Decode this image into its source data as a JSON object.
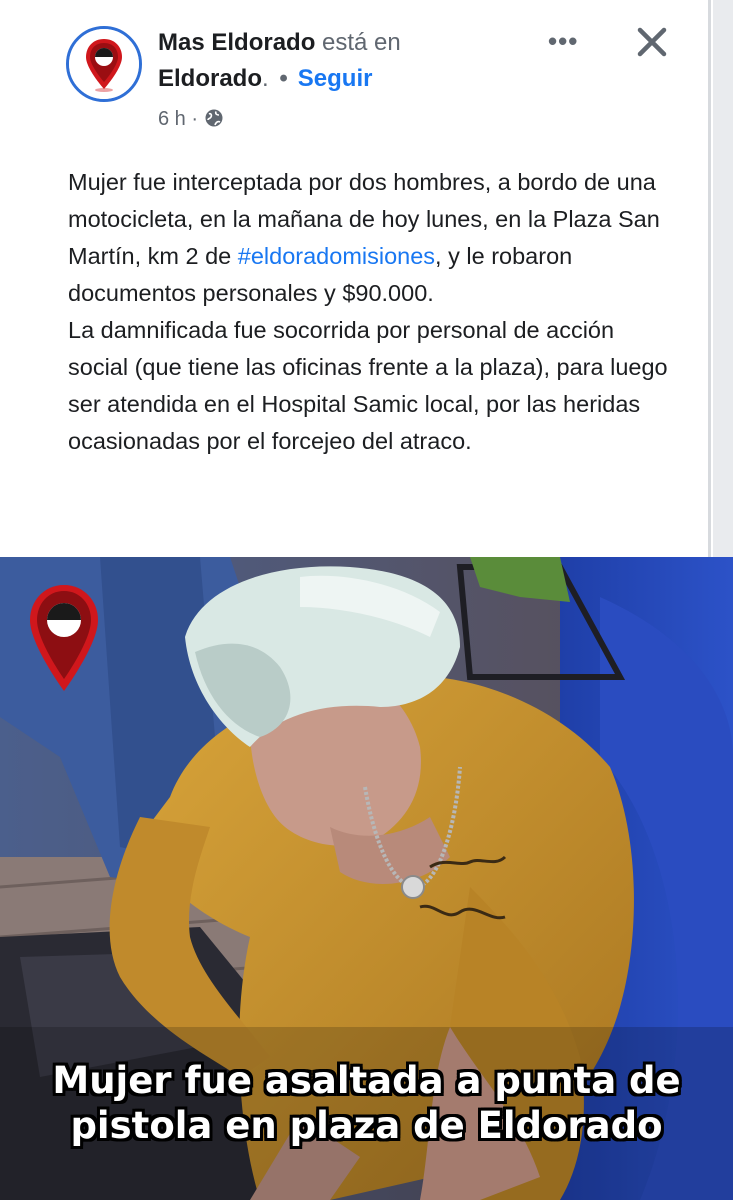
{
  "header": {
    "author_name": "Mas Eldorado",
    "checkin_text": " está en",
    "place": "Eldorado",
    "place_suffix": ".",
    "separator": "•",
    "follow_label": "Seguir",
    "time": "6 h",
    "meta_separator": "·",
    "audience_icon": "globe-icon",
    "more_icon": "more-options-icon",
    "more_text": "•••",
    "close_icon": "close-icon"
  },
  "post": {
    "text_line1_a": "Mujer fue interceptada por dos hombres, a bordo de una motocicleta, en la mañana de hoy lunes, en la Plaza San Martín, km 2 de ",
    "hashtag": "#eldoradomisiones",
    "text_line1_b": ", y le robaron documentos personales y $90.000.",
    "text_para2": "La damnificada fue socorrida por personal de acción social (que tiene las oficinas frente a la plaza), para luego ser atendida en el Hospital Samic local, por las heridas ocasionadas por el forcejeo del atraco."
  },
  "image": {
    "caption_line1": "Mujer fue asaltada a punta de",
    "caption_line2": "pistola en plaza de Eldorado",
    "logo_icon": "location-pin-logo"
  },
  "colors": {
    "link": "#1877f2",
    "avatar_border": "#2f6fd6",
    "pin_red": "#d0171c",
    "shirt": "#c9952c"
  }
}
